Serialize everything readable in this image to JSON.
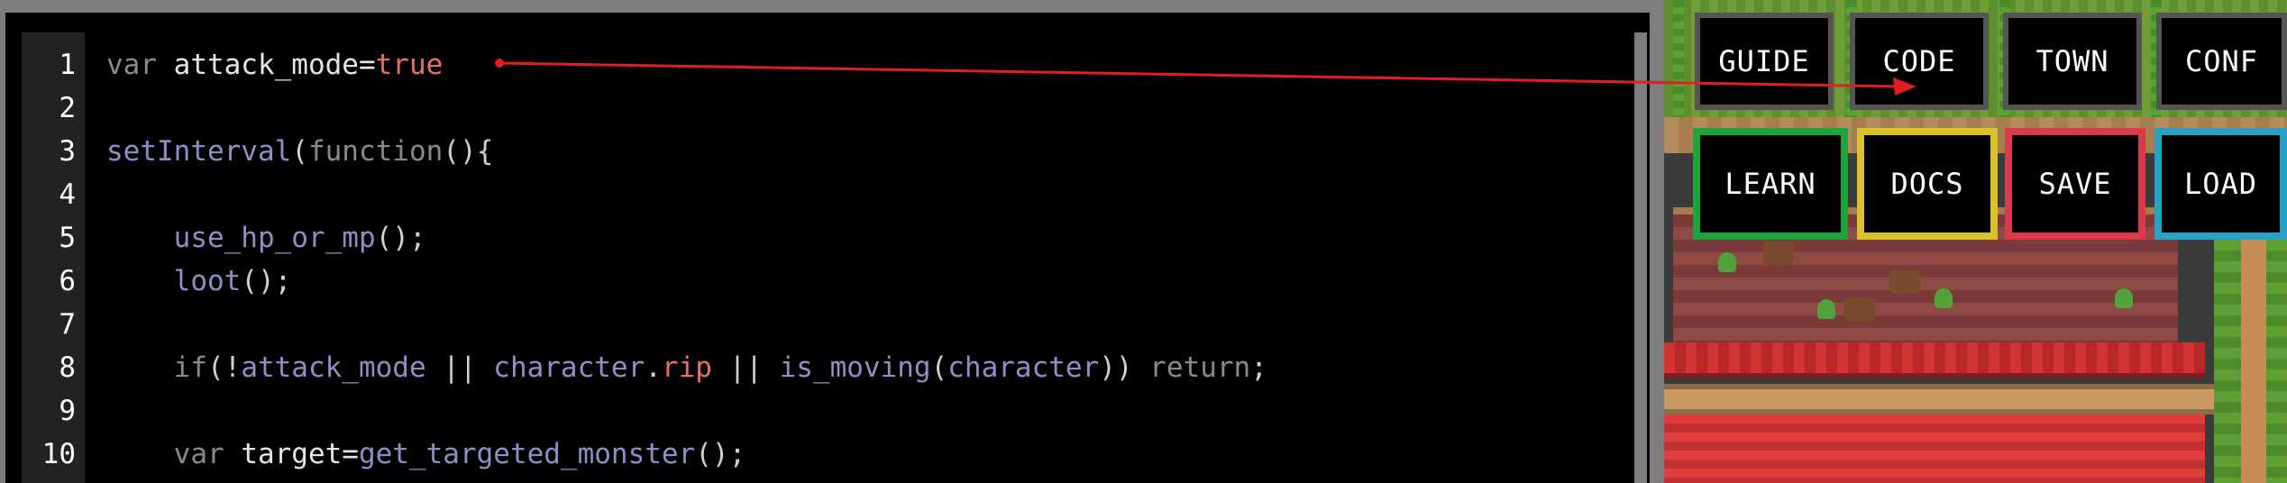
{
  "editor": {
    "lines": [
      {
        "num": "1",
        "tokens": [
          {
            "t": "var ",
            "c": "tok-kw"
          },
          {
            "t": "attack_mode",
            "c": "tok-var"
          },
          {
            "t": "=",
            "c": "tok-var"
          },
          {
            "t": "true",
            "c": "tok-lit"
          }
        ]
      },
      {
        "num": "2",
        "tokens": []
      },
      {
        "num": "3",
        "tokens": [
          {
            "t": "setInterval",
            "c": "tok-fn"
          },
          {
            "t": "(",
            "c": "tok-punct"
          },
          {
            "t": "function",
            "c": "tok-kw"
          },
          {
            "t": "(){",
            "c": "tok-punct"
          }
        ]
      },
      {
        "num": "4",
        "tokens": []
      },
      {
        "num": "5",
        "tokens": [
          {
            "t": "    use_hp_or_mp",
            "c": "tok-fn"
          },
          {
            "t": "();",
            "c": "tok-punct"
          }
        ]
      },
      {
        "num": "6",
        "tokens": [
          {
            "t": "    loot",
            "c": "tok-fn"
          },
          {
            "t": "();",
            "c": "tok-punct"
          }
        ]
      },
      {
        "num": "7",
        "tokens": []
      },
      {
        "num": "8",
        "tokens": [
          {
            "t": "    if",
            "c": "tok-kw"
          },
          {
            "t": "(!",
            "c": "tok-punct"
          },
          {
            "t": "attack_mode",
            "c": "tok-fn"
          },
          {
            "t": " || ",
            "c": "tok-punct"
          },
          {
            "t": "character",
            "c": "tok-fn"
          },
          {
            "t": ".",
            "c": "tok-punct"
          },
          {
            "t": "rip",
            "c": "tok-prop"
          },
          {
            "t": " || ",
            "c": "tok-punct"
          },
          {
            "t": "is_moving",
            "c": "tok-fn"
          },
          {
            "t": "(",
            "c": "tok-punct"
          },
          {
            "t": "character",
            "c": "tok-fn"
          },
          {
            "t": ")) ",
            "c": "tok-punct"
          },
          {
            "t": "return",
            "c": "tok-kw"
          },
          {
            "t": ";",
            "c": "tok-punct"
          }
        ]
      },
      {
        "num": "9",
        "tokens": []
      },
      {
        "num": "10",
        "tokens": [
          {
            "t": "    var ",
            "c": "tok-kw"
          },
          {
            "t": "target",
            "c": "tok-var"
          },
          {
            "t": "=",
            "c": "tok-var"
          },
          {
            "t": "get_targeted_monster",
            "c": "tok-fn"
          },
          {
            "t": "();",
            "c": "tok-punct"
          }
        ]
      }
    ]
  },
  "menu": {
    "top_row": [
      "GUIDE",
      "CODE",
      "TOWN",
      "CONF"
    ],
    "bottom_row": [
      "LEARN",
      "DOCS",
      "SAVE",
      "LOAD"
    ]
  },
  "colors": {
    "arrow": "#e02020",
    "learn_border": "#1fa33b",
    "docs_border": "#d9c22a",
    "save_border": "#d83a4c",
    "load_border": "#2aa0c2"
  }
}
